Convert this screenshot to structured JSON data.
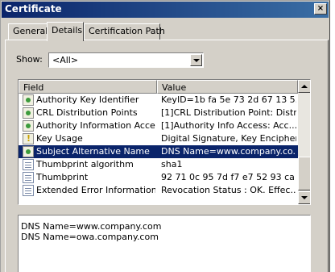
{
  "window": {
    "title": "Certificate",
    "close_glyph": "×"
  },
  "tabs": [
    {
      "label": "General"
    },
    {
      "label": "Details"
    },
    {
      "label": "Certification Path"
    }
  ],
  "show": {
    "label": "Show:",
    "value": "<All>"
  },
  "list": {
    "columns": [
      "Field",
      "Value"
    ],
    "rows": [
      {
        "icon": "green-cert-icon",
        "field": "Authority Key Identifier",
        "value": "KeyID=1b fa 5e 73 2d 67 13 5..."
      },
      {
        "icon": "green-cert-icon",
        "field": "CRL Distribution Points",
        "value": "[1]CRL Distribution Point: Distr..."
      },
      {
        "icon": "green-cert-icon",
        "field": "Authority Information Access",
        "value": "[1]Authority Info Access: Acc..."
      },
      {
        "icon": "warning-cert-icon",
        "field": "Key Usage",
        "value": "Digital Signature, Key Encipher..."
      },
      {
        "icon": "green-cert-icon",
        "field": "Subject Alternative Name",
        "value": "DNS Name=www.company.co...",
        "selected": true
      },
      {
        "icon": "document-icon",
        "field": "Thumbprint algorithm",
        "value": "sha1"
      },
      {
        "icon": "document-icon",
        "field": "Thumbprint",
        "value": "92 71 0c 95 7d f7 e7 52 93 ca ..."
      },
      {
        "icon": "document-icon",
        "field": "Extended Error Information",
        "value": "Revocation Status : OK. Effec..."
      }
    ]
  },
  "detail": {
    "lines": [
      "DNS Name=www.company.com",
      "DNS Name=owa.company.com"
    ]
  }
}
